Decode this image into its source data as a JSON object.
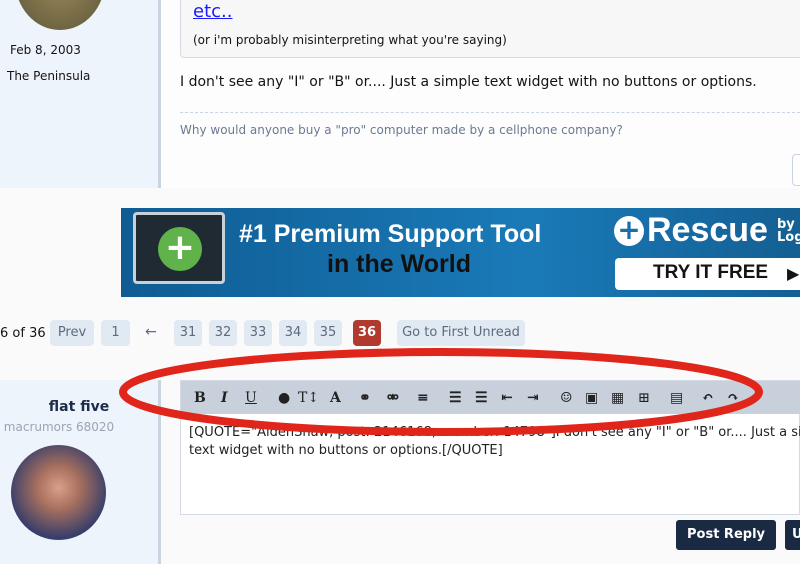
{
  "prev_post": {
    "joined": "Feb 8, 2003",
    "location": "The Peninsula",
    "quote_link": "etc..",
    "quote_text": "(or i'm probably misinterpreting what you're saying)",
    "body": "I don't see any \"I\" or \"B\" or.... Just a simple text widget with no buttons or options.",
    "signature": "Why would anyone buy a \"pro\" computer made by a cellphone company?"
  },
  "ad": {
    "headline1": "#1 Premium Support Tool",
    "headline2": "in the World",
    "brand": "Rescue",
    "brand_suffix": "by Log",
    "cta": "TRY IT FREE",
    "color": "#1a6fa8"
  },
  "pagination": {
    "info": "6 of 36",
    "prev": "Prev",
    "first": "1",
    "arrow": "←",
    "pages": [
      "31",
      "32",
      "33",
      "34",
      "35"
    ],
    "current": "36",
    "first_unread": "Go to First Unread",
    "current_color": "#b03a2e"
  },
  "reply": {
    "username": "flat five",
    "user_title": "macrumors 68020",
    "toolbar": [
      "bold",
      "italic",
      "underline",
      "color",
      "font-size",
      "font",
      "link",
      "unlink",
      "align",
      "bullet-list",
      "numbered-list",
      "outdent",
      "indent",
      "smilie",
      "image",
      "media",
      "insert",
      "save",
      "undo",
      "redo"
    ],
    "text": "[QUOTE=\"AidenShaw, post: 2146168, member: 14798\"]I don't see any \"I\" or \"B\" or.... Just a simple text widget with no buttons or options.[/QUOTE]",
    "post_reply": "Post Reply",
    "upload": "U"
  },
  "annotation_color": "#e0261b"
}
